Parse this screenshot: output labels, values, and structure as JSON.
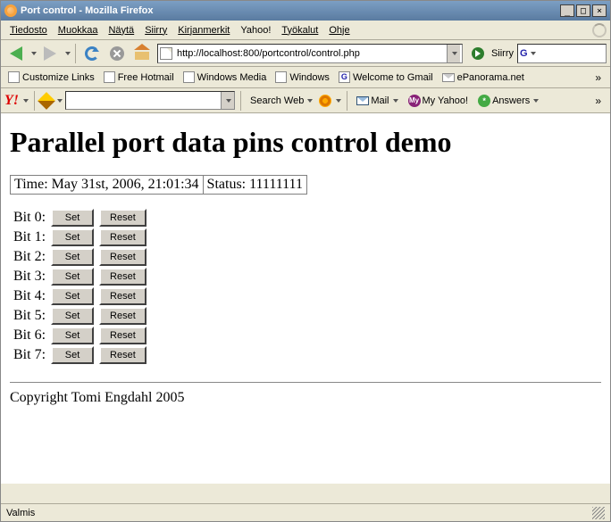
{
  "window": {
    "title": "Port control - Mozilla Firefox"
  },
  "menu": {
    "items": [
      "Tiedosto",
      "Muokkaa",
      "Näytä",
      "Siirry",
      "Kirjanmerkit",
      "Yahoo!",
      "Työkalut",
      "Ohje"
    ]
  },
  "locationbar": {
    "url": "http://localhost:800/portcontrol/control.php",
    "go_label": "Siirry"
  },
  "bookmarks": {
    "items": [
      "Customize Links",
      "Free Hotmail",
      "Windows Media",
      "Windows",
      "Welcome to Gmail",
      "ePanorama.net"
    ]
  },
  "yahoo": {
    "search_label": "Search Web",
    "mail_label": "Mail",
    "my_label": "My Yahoo!",
    "answers_label": "Answers"
  },
  "page": {
    "heading": "Parallel port data pins control demo",
    "time_label": "Time: May 31st, 2006, 21:01:34",
    "status_label": "Status: 11111111",
    "bits": [
      {
        "label": "Bit 0:",
        "set": "Set",
        "reset": "Reset"
      },
      {
        "label": "Bit 1:",
        "set": "Set",
        "reset": "Reset"
      },
      {
        "label": "Bit 2:",
        "set": "Set",
        "reset": "Reset"
      },
      {
        "label": "Bit 3:",
        "set": "Set",
        "reset": "Reset"
      },
      {
        "label": "Bit 4:",
        "set": "Set",
        "reset": "Reset"
      },
      {
        "label": "Bit 5:",
        "set": "Set",
        "reset": "Reset"
      },
      {
        "label": "Bit 6:",
        "set": "Set",
        "reset": "Reset"
      },
      {
        "label": "Bit 7:",
        "set": "Set",
        "reset": "Reset"
      }
    ],
    "copyright": "Copyright Tomi Engdahl 2005"
  },
  "statusbar": {
    "text": "Valmis"
  }
}
